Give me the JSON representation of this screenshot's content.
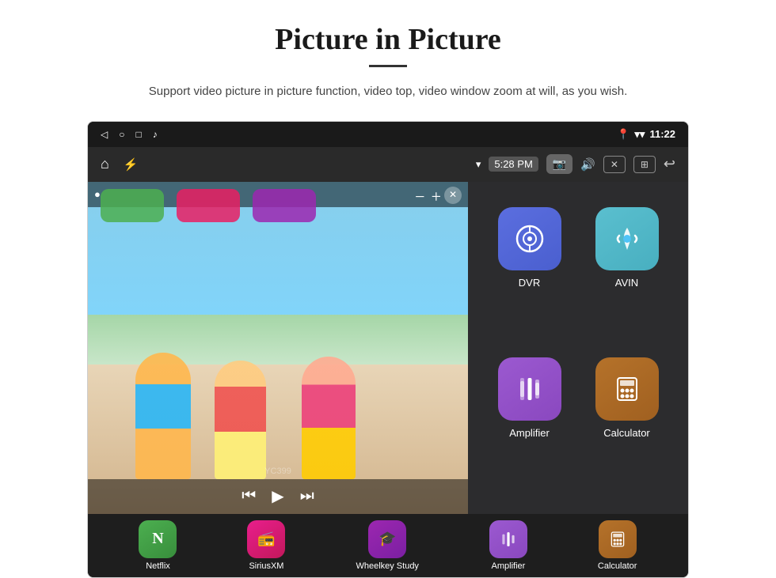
{
  "page": {
    "title": "Picture in Picture",
    "subtitle": "Support video picture in picture function, video top, video window zoom at will, as you wish.",
    "divider": true
  },
  "status_bar": {
    "back_icon": "◁",
    "home_icon": "○",
    "square_icon": "□",
    "music_icon": "♪",
    "signal_icon": "▾▾",
    "time": "11:22"
  },
  "nav_bar": {
    "home_icon": "⌂",
    "usb_icon": "⚡",
    "wifi_icon": "▾",
    "time": "5:28 PM",
    "camera_icon": "📷",
    "volume_icon": "🔊",
    "close_icon": "✕",
    "pip_icon": "⊞",
    "back_icon": "↩"
  },
  "pip_window": {
    "record_icon": "●",
    "minus": "−",
    "plus": "+",
    "close": "✕",
    "prev": "⏮",
    "play": "▶",
    "next": "⏭",
    "watermark": "YC399"
  },
  "top_apps": [
    {
      "color": "chip-green"
    },
    {
      "color": "chip-pink"
    },
    {
      "color": "chip-purple"
    }
  ],
  "app_grid": [
    {
      "id": "dvr",
      "icon_class": "icon-dvr",
      "label": "DVR",
      "icon_symbol": "📡"
    },
    {
      "id": "avin",
      "icon_class": "icon-avin",
      "label": "AVIN",
      "icon_symbol": "🔌"
    },
    {
      "id": "amplifier",
      "icon_class": "icon-amplifier",
      "label": "Amplifier",
      "icon_symbol": "🎚"
    },
    {
      "id": "calculator",
      "icon_class": "icon-calculator",
      "label": "Calculator",
      "icon_symbol": "🧮"
    }
  ],
  "bottom_strip": [
    {
      "id": "netflix",
      "icon_class": "icon-netflix",
      "label": "Netflix",
      "icon_symbol": "▶"
    },
    {
      "id": "siriusxm",
      "icon_class": "icon-sirius",
      "label": "SiriusXM",
      "icon_symbol": "📻"
    },
    {
      "id": "wheelkey",
      "icon_class": "icon-wheelkey",
      "label": "Wheelkey Study",
      "icon_symbol": "🎓"
    },
    {
      "id": "amplifier-strip",
      "icon_class": "icon-amplifier",
      "label": "Amplifier",
      "icon_symbol": "🎚"
    },
    {
      "id": "calculator-strip",
      "icon_class": "icon-calculator",
      "label": "Calculator",
      "icon_symbol": "🧮"
    }
  ]
}
